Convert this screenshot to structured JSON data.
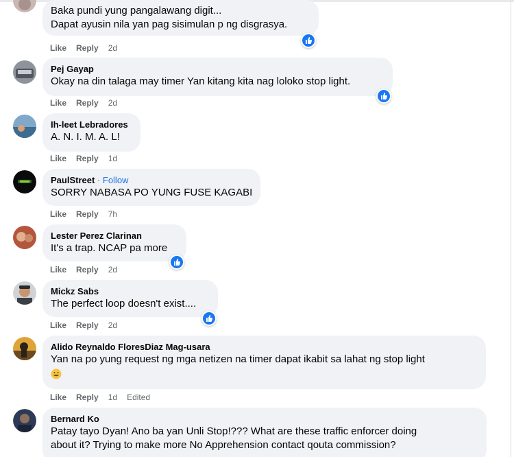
{
  "labels": {
    "like": "Like",
    "reply": "Reply",
    "follow": "Follow",
    "edited": "Edited"
  },
  "comments": [
    {
      "author": "",
      "lines": [
        "Baka pundi yung pangalawang digit...",
        "Dapat ayusin nila yan pag sisimulan p ng disgrasya."
      ],
      "time": "2d",
      "reaction": "like-icon"
    },
    {
      "author": "Pej Gayap",
      "lines": [
        "Okay na din talaga may timer Yan kitang kita nag loloko stop light."
      ],
      "time": "2d",
      "reaction": "like-icon"
    },
    {
      "author": "Ih-leet Lebradores",
      "lines": [
        "A. N. I. M. A. L!"
      ],
      "time": "1d"
    },
    {
      "author": "PaulStreet",
      "lines": [
        "SORRY NABASA PO YUNG FUSE KAGABI"
      ],
      "time": "7h",
      "follow": true
    },
    {
      "author": "Lester Perez Clarinan",
      "lines": [
        "It's a trap. NCAP pa more"
      ],
      "time": "2d",
      "reaction": "like-icon"
    },
    {
      "author": "Mickz Sabs",
      "lines": [
        "The perfect loop doesn't exist...."
      ],
      "time": "2d",
      "reaction": "like-icon"
    },
    {
      "author": "Alido Reynaldo FloresDiaz Mag-usara",
      "lines": [
        "Yan na po yung request ng mga netizen na timer dapat ikabit sa lahat ng stop light"
      ],
      "time": "1d",
      "edited": true,
      "emoji": "grinning-face-emoji"
    },
    {
      "author": "Bernard Ko",
      "lines": [
        "Patay tayo Dyan! Ano ba yan Unli Stop!??? What are these traffic enforcer doing",
        "about it? Trying to make more No Apprehension contact qouta commission?"
      ]
    }
  ],
  "colors": {
    "bubble": "#f0f2f5",
    "link": "#1b74e4",
    "meta": "#65676b",
    "like_blue": "#1877f2"
  }
}
